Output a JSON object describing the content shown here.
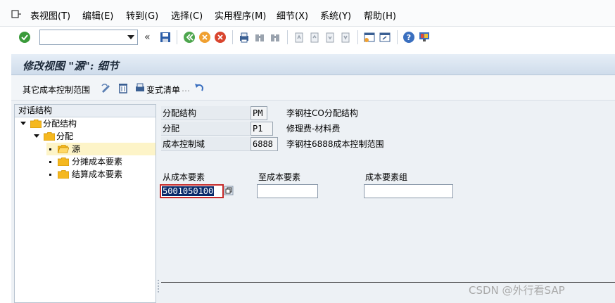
{
  "menu": [
    {
      "label": "表视图(T)"
    },
    {
      "label": "编辑(E)"
    },
    {
      "label": "转到(G)"
    },
    {
      "label": "选择(C)"
    },
    {
      "label": "实用程序(M)"
    },
    {
      "label": "细节(X)"
    },
    {
      "label": "系统(Y)"
    },
    {
      "label": "帮助(H)"
    }
  ],
  "toolbar": {
    "command_value": "",
    "collapse_glyph": "«",
    "icons": [
      "enter-icon",
      "save-icon",
      "back-icon",
      "exit-icon",
      "cancel-icon",
      "print-icon",
      "find-icon",
      "find-next-icon",
      "first-page-icon",
      "prev-page-icon",
      "next-page-icon",
      "last-page-icon",
      "create-session-icon",
      "shortcut-icon",
      "help-icon",
      "layout-icon"
    ]
  },
  "title": "修改视图 \"源\": 细节",
  "app_toolbar": {
    "other_range": "其它成本控制范围",
    "variant_list": "变式清单",
    "variant_list_dash": "…"
  },
  "tree": {
    "header": "对话结构",
    "nodes": [
      {
        "label": "分配结构",
        "level": 0,
        "type": "expanded"
      },
      {
        "label": "分配",
        "level": 1,
        "type": "expanded"
      },
      {
        "label": "源",
        "level": 2,
        "type": "leaf",
        "selected": true
      },
      {
        "label": "分摊成本要素",
        "level": 2,
        "type": "leaf"
      },
      {
        "label": "结算成本要素",
        "level": 2,
        "type": "leaf"
      }
    ]
  },
  "fields": [
    {
      "label": "分配结构",
      "value": "PM",
      "desc": "李钢柱CO分配结构"
    },
    {
      "label": "分配",
      "value": "P1",
      "desc": "修理费-材料费"
    },
    {
      "label": "成本控制域",
      "value": "6888",
      "desc": "李钢柱6888成本控制范围"
    }
  ],
  "form": {
    "from_label": "从成本要素",
    "from_value": "5001050100",
    "to_label": "至成本要素",
    "to_value": "",
    "group_label": "成本要素组",
    "group_value": ""
  },
  "watermark": "CSDN @外行看SAP"
}
